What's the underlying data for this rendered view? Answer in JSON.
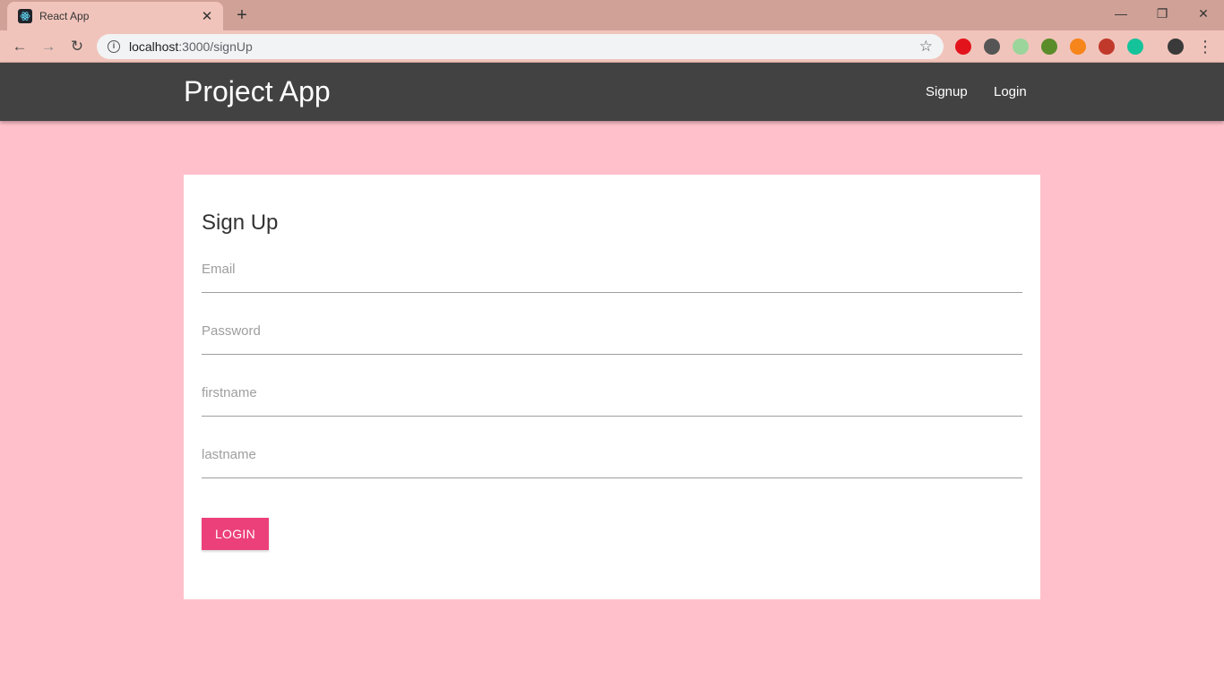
{
  "browser": {
    "tab_title": "React App",
    "url_host": "localhost",
    "url_path": ":3000/signUp",
    "extensions": [
      {
        "name": "opera-adblock-icon",
        "color": "#e3131b"
      },
      {
        "name": "json-formatter-icon",
        "color": "#555555"
      },
      {
        "name": "colorzilla-icon",
        "color": "#9bd59b"
      },
      {
        "name": "earth-icon",
        "color": "#5b8c2a"
      },
      {
        "name": "metamask-icon",
        "color": "#f6851b"
      },
      {
        "name": "screenshot-icon",
        "color": "#c0392b"
      },
      {
        "name": "grammarly-icon",
        "color": "#15c39a"
      }
    ]
  },
  "navbar": {
    "brand": "Project App",
    "links": [
      "Signup",
      "Login"
    ]
  },
  "form": {
    "title": "Sign Up",
    "fields": {
      "email": "Email",
      "password": "Password",
      "firstname": "firstname",
      "lastname": "lastname"
    },
    "submit_label": "LOGIN",
    "accent": "#ec407a"
  }
}
